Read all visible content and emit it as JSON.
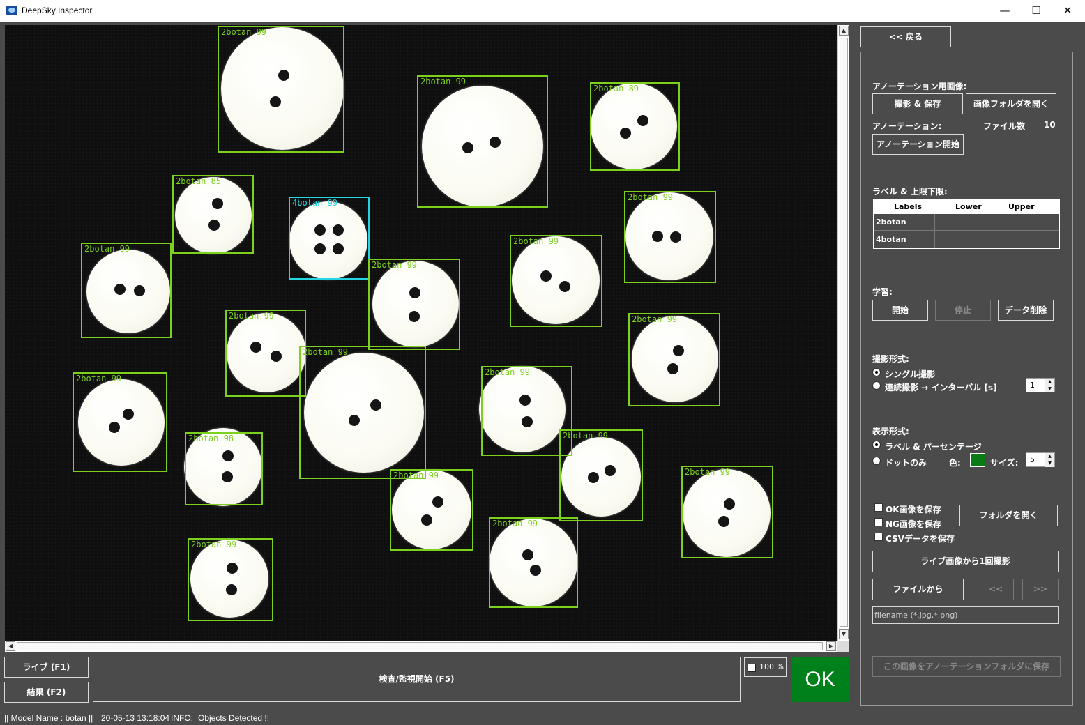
{
  "window": {
    "title": "DeepSky Inspector",
    "minimize": "—",
    "maximize": "☐",
    "close": "✕"
  },
  "detections": [
    {
      "label": "2botan 99"
    },
    {
      "label": "2botan 99"
    },
    {
      "label": "2botan 89"
    },
    {
      "label": "2botan 85"
    },
    {
      "label": "4botan 99"
    },
    {
      "label": "2botan 99"
    },
    {
      "label": "2botan 99"
    },
    {
      "label": "2botan 99"
    },
    {
      "label": "2botan 99"
    },
    {
      "label": "2botan 99"
    },
    {
      "label": "2botan 99"
    },
    {
      "label": "2botan 99"
    },
    {
      "label": "2botan 99"
    },
    {
      "label": "2botan 99"
    },
    {
      "label": "2botan 98"
    },
    {
      "label": "2botan 99"
    },
    {
      "label": "2botan 99"
    },
    {
      "label": "2botan 99"
    },
    {
      "label": "2botan 99"
    },
    {
      "label": "2botan 99"
    }
  ],
  "bottom": {
    "live_button": "ライブ (F1)",
    "result_button": "結果 (F2)",
    "inspect_button": "検査/監視開始 (F5)",
    "zoom_label": "100 %",
    "status_verdict": "OK"
  },
  "statusbar": {
    "model": "|| Model Name : botan ||",
    "datetime": "20-05-13 13:18:04",
    "info_label": "INFO:",
    "info_text": "Objects Detected !!"
  },
  "panel": {
    "back_button": "<< 戻る",
    "annot_image_heading": "アノーテーション用画像:",
    "capture_save_button": "撮影 & 保存",
    "open_image_folder_button": "画像フォルダを開く",
    "annotation_heading": "アノーテーション:",
    "file_count_label": "ファイル数",
    "file_count_value": "10",
    "start_annotation_button": "アノーテーション開始",
    "label_limits_heading": "ラベル & 上限下限:",
    "table": {
      "headers": [
        "Labels",
        "Lower",
        "Upper"
      ],
      "rows": [
        [
          "2botan",
          "",
          ""
        ],
        [
          "4botan",
          "",
          ""
        ]
      ]
    },
    "learning_heading": "学習:",
    "start_button": "開始",
    "stop_button": "停止",
    "delete_data_button": "データ削除",
    "capture_mode_heading": "撮影形式:",
    "single_capture": "シングル撮影",
    "continuous_capture": "連続撮影 → インターバル [s]",
    "interval_value": "1",
    "display_mode_heading": "表示形式:",
    "label_percentage": "ラベル & パーセンテージ",
    "dot_only": "ドットのみ",
    "color_label": "色:",
    "size_label": "サイズ:",
    "size_value": "5",
    "save_ok": "OK画像を保存",
    "save_ng": "NG画像を保存",
    "save_csv": "CSVデータを保存",
    "open_folder_button": "フォルダを開く",
    "capture_from_live_button": "ライブ画像から1回撮影",
    "from_file_button": "ファイルから",
    "prev_button": "<<",
    "next_button": ">>",
    "filename_placeholder": "filename (*.jpg,*.png)",
    "save_to_annot_button": "この画像をアノーテーションフォルダに保存",
    "accent_color": "#00801a",
    "detection_color": "#7cd11d",
    "detection_color_4hole": "#22d7e3"
  }
}
